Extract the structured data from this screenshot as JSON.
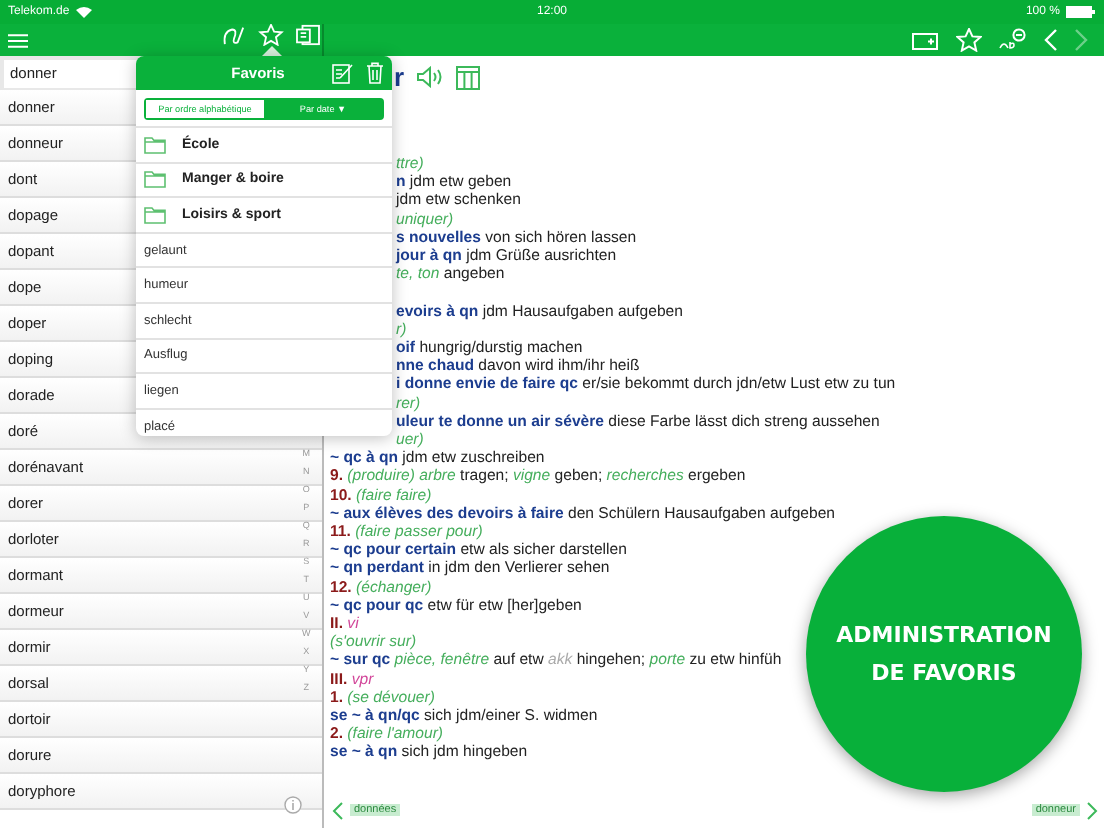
{
  "status_bar": {
    "carrier": "Telekom.de",
    "time": "12:00",
    "battery": "100 %"
  },
  "toolbar": {
    "center_tools": [
      {
        "kind": "handwriting",
        "selected": false
      },
      {
        "kind": "star",
        "selected": true
      },
      {
        "kind": "cards",
        "selected": false
      }
    ],
    "right_tools": [
      {
        "kind": "add-card",
        "disabled": false
      },
      {
        "kind": "star",
        "disabled": false
      },
      {
        "kind": "abc-minus",
        "disabled": false
      },
      {
        "kind": "back",
        "disabled": false
      },
      {
        "kind": "forward",
        "disabled": true
      }
    ]
  },
  "search": {
    "value": "donner"
  },
  "word_list": [
    "donner",
    "donneur",
    "dont",
    "dopage",
    "dopant",
    "dope",
    "doper",
    "doping",
    "dorade",
    "doré",
    "dorénavant",
    "dorer",
    "dorloter",
    "dormant",
    "dormeur",
    "dormir",
    "dorsal",
    "dortoir",
    "dorure",
    "doryphore"
  ],
  "index_letters": [
    "M",
    "N",
    "O",
    "P",
    "Q",
    "R",
    "S",
    "T",
    "U",
    "V",
    "W",
    "X",
    "Y",
    "Z"
  ],
  "favorites_popover": {
    "title": "Favoris",
    "sort_options": [
      {
        "label": "Par ordre alphabétique",
        "selected": false
      },
      {
        "label": "Par date ▼",
        "selected": true
      }
    ],
    "items": [
      {
        "kind": "folder",
        "label": "École"
      },
      {
        "kind": "folder",
        "label": "Manger & boire"
      },
      {
        "kind": "folder",
        "label": "Loisirs & sport"
      },
      {
        "kind": "word",
        "label": "gelaunt"
      },
      {
        "kind": "word",
        "label": "humeur"
      },
      {
        "kind": "word",
        "label": "schlecht"
      },
      {
        "kind": "word",
        "label": "Ausflug"
      },
      {
        "kind": "word",
        "label": "liegen"
      },
      {
        "kind": "word",
        "label": "placé"
      }
    ]
  },
  "entry": {
    "headword": "r",
    "covered_groups": [
      [
        {
          "segments": [
            {
              "kind": "sense",
              "text": "ttre)"
            }
          ]
        },
        {
          "segments": [
            {
              "kind": "term",
              "text": "n"
            },
            {
              "kind": "text",
              "text": " jdm etw geben"
            }
          ]
        },
        {
          "segments": [
            {
              "kind": "text",
              "text": "jdm etw schenken"
            }
          ]
        },
        {
          "segments": [
            {
              "kind": "sense",
              "text": "uniquer)"
            }
          ]
        },
        {
          "segments": [
            {
              "kind": "term",
              "text": "s nouvelles"
            },
            {
              "kind": "text",
              "text": " von sich hören lassen"
            }
          ]
        },
        {
          "segments": [
            {
              "kind": "term",
              "text": "jour à qn"
            },
            {
              "kind": "text",
              "text": " jdm Grüße ausrichten"
            }
          ]
        },
        {
          "segments": [
            {
              "kind": "sense",
              "text": "te, ton"
            },
            {
              "kind": "text",
              "text": " angeben"
            }
          ]
        }
      ],
      [
        {
          "segments": [
            {
              "kind": "term",
              "text": "evoirs à qn"
            },
            {
              "kind": "text",
              "text": " jdm Hausaufgaben aufgeben"
            }
          ]
        },
        {
          "segments": [
            {
              "kind": "sense",
              "text": "r)"
            }
          ]
        },
        {
          "segments": [
            {
              "kind": "term",
              "text": "oif"
            },
            {
              "kind": "text",
              "text": " hungrig/durstig machen"
            }
          ]
        },
        {
          "segments": [
            {
              "kind": "term",
              "text": "nne chaud"
            },
            {
              "kind": "text",
              "text": " davon wird ihm/ihr heiß"
            }
          ]
        },
        {
          "segments": [
            {
              "kind": "term",
              "text": "i donne envie de faire qc"
            },
            {
              "kind": "text",
              "text": " er/sie bekommt durch jdn/etw Lust etw zu tun"
            }
          ]
        },
        {
          "segments": [
            {
              "kind": "sense",
              "text": "rer)"
            }
          ]
        },
        {
          "segments": [
            {
              "kind": "term",
              "text": "uleur te donne un air sévère"
            },
            {
              "kind": "text",
              "text": " diese Farbe lässt dich streng aussehen"
            }
          ]
        },
        {
          "segments": [
            {
              "kind": "sense",
              "text": "uer)"
            }
          ]
        }
      ]
    ],
    "lines": [
      {
        "segments": [
          {
            "kind": "term",
            "text": "~ qc à qn"
          },
          {
            "kind": "text",
            "text": " jdm etw zuschreiben"
          }
        ]
      },
      {
        "segments": [
          {
            "kind": "num",
            "text": "9."
          },
          {
            "kind": "sense",
            "text": " (produire) arbre"
          },
          {
            "kind": "text",
            "text": " tragen; "
          },
          {
            "kind": "sense",
            "text": "vigne"
          },
          {
            "kind": "text",
            "text": " geben; "
          },
          {
            "kind": "sense",
            "text": "recherches"
          },
          {
            "kind": "text",
            "text": " ergeben"
          }
        ]
      },
      {
        "segments": [
          {
            "kind": "num",
            "text": "10."
          },
          {
            "kind": "sense",
            "text": " (faire faire)"
          }
        ]
      },
      {
        "segments": [
          {
            "kind": "term",
            "text": "~ aux élèves des devoirs à faire"
          },
          {
            "kind": "text",
            "text": " den Schülern Hausaufgaben aufgeben"
          }
        ]
      },
      {
        "segments": [
          {
            "kind": "num",
            "text": "11."
          },
          {
            "kind": "sense",
            "text": " (faire passer pour)"
          }
        ]
      },
      {
        "segments": [
          {
            "kind": "term",
            "text": "~ qc pour certain"
          },
          {
            "kind": "text",
            "text": " etw als sicher darstellen"
          }
        ]
      },
      {
        "segments": [
          {
            "kind": "term",
            "text": "~ qn perdant"
          },
          {
            "kind": "text",
            "text": " in jdm den Verlierer sehen"
          }
        ]
      },
      {
        "segments": [
          {
            "kind": "num",
            "text": "12."
          },
          {
            "kind": "sense",
            "text": " (échanger)"
          }
        ]
      },
      {
        "segments": [
          {
            "kind": "term",
            "text": "~ qc pour qc"
          },
          {
            "kind": "text",
            "text": " etw für etw [her]geben"
          }
        ]
      },
      {
        "segments": [
          {
            "kind": "num",
            "text": "II."
          },
          {
            "kind": "gram",
            "text": " vi"
          }
        ]
      },
      {
        "segments": [
          {
            "kind": "sense",
            "text": "(s'ouvrir sur)"
          }
        ]
      },
      {
        "segments": [
          {
            "kind": "term",
            "text": "~ sur qc"
          },
          {
            "kind": "sense",
            "text": " pièce, fenêtre"
          },
          {
            "kind": "text",
            "text": " auf etw "
          },
          {
            "kind": "grey",
            "text": "akk"
          },
          {
            "kind": "text",
            "text": " hingehen; "
          },
          {
            "kind": "sense",
            "text": "porte"
          },
          {
            "kind": "text",
            "text": " zu etw hinfüh"
          }
        ]
      },
      {
        "segments": [
          {
            "kind": "num",
            "text": "III."
          },
          {
            "kind": "gram",
            "text": " vpr"
          }
        ]
      },
      {
        "segments": [
          {
            "kind": "num",
            "text": "1."
          },
          {
            "kind": "sense",
            "text": " (se dévouer)"
          }
        ]
      },
      {
        "segments": [
          {
            "kind": "term",
            "text": "se ~ à qn/qc"
          },
          {
            "kind": "text",
            "text": " sich jdm/einer S. widmen"
          }
        ]
      },
      {
        "segments": [
          {
            "kind": "num",
            "text": "2."
          },
          {
            "kind": "sense",
            "text": " (faire l'amour)"
          }
        ]
      },
      {
        "segments": [
          {
            "kind": "term",
            "text": "se ~ à qn"
          },
          {
            "kind": "text",
            "text": " sich jdm hingeben"
          }
        ]
      }
    ]
  },
  "nav": {
    "prev": "données",
    "next": "donneur"
  },
  "badge": {
    "text": "ADMINISTRATION DE FAVORIS"
  }
}
